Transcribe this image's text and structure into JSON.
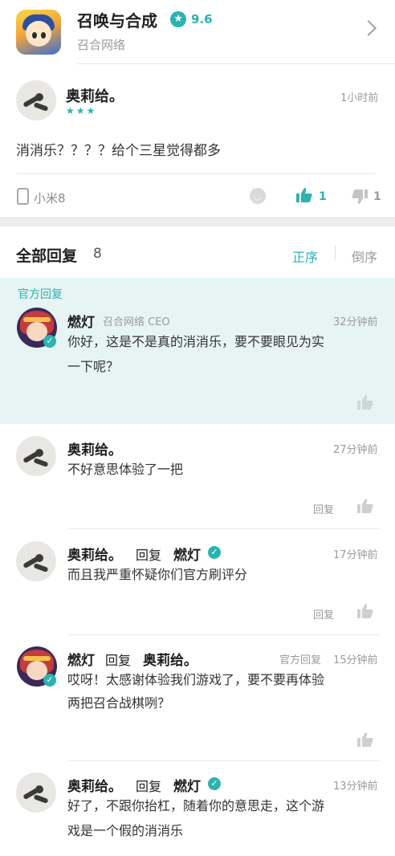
{
  "app": {
    "title": "召唤与合成",
    "rating": "9.6",
    "developer": "召合网络"
  },
  "review": {
    "author": "奥莉给。",
    "stars": "★★★",
    "time": "1小时前",
    "text": "消消乐？？？？给个三星觉得都多",
    "device": "小米8",
    "like_count": "1",
    "dislike_count": "1"
  },
  "replies_section": {
    "title": "全部回复",
    "count": "8",
    "sort_asc": "正序",
    "sort_desc": "倒序",
    "official_label": "官方回复"
  },
  "replies": [
    {
      "author": "燃灯",
      "subtitle": "召合网络 CEO",
      "time": "32分钟前",
      "line1": "你好，这是不是真的消消乐，要不要眼见为实",
      "line2": "一下呢？"
    },
    {
      "author": "奥莉给。",
      "time": "27分钟前",
      "line1": "不好意思体验了一把",
      "action": "回复"
    },
    {
      "author": "奥莉给。",
      "reply_word": "回复",
      "target": "燃灯",
      "time": "17分钟前",
      "line1": "而且我严重怀疑你们官方刷评分",
      "action": "回复"
    },
    {
      "author": "燃灯",
      "reply_word": "回复",
      "target": "奥莉给。",
      "official_tag": "官方回复",
      "time": "15分钟前",
      "line1": "哎呀！太感谢体验我们游戏了，要不要再体验",
      "line2": "两把召合战棋咧？"
    },
    {
      "author": "奥莉给。",
      "reply_word": "回复",
      "target": "燃灯",
      "time": "13分钟前",
      "line1": "好了，不跟你抬杠，随着你的意思走，这个游",
      "line2": "戏是一个假的消消乐"
    }
  ],
  "colors": {
    "accent": "#2bb3b0",
    "official_bg": "#e6f5f4",
    "muted": "#9a9a9a"
  }
}
